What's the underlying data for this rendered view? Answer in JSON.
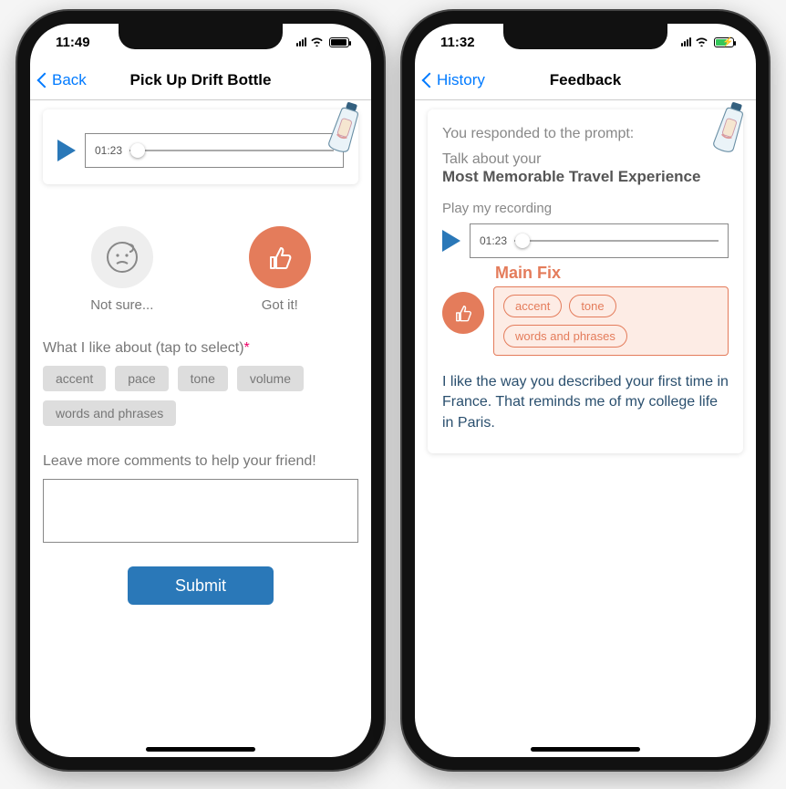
{
  "left": {
    "status_time": "11:49",
    "back_label": "Back",
    "title": "Pick Up Drift Bottle",
    "time_code": "01:23",
    "not_sure_label": "Not sure...",
    "got_it_label": "Got it!",
    "like_label_prefix": "What I like about (tap to select)",
    "chips": [
      "accent",
      "pace",
      "tone",
      "volume",
      "words and phrases"
    ],
    "comment_label": "Leave more comments to help your friend!",
    "submit_label": "Submit"
  },
  "right": {
    "status_time": "11:32",
    "back_label": "History",
    "title": "Feedback",
    "intro": "You responded to the prompt:",
    "topic_prefix": "Talk about your",
    "topic": "Most Memorable Travel Experience",
    "play_label": "Play my recording",
    "time_code": "01:23",
    "mainfix_label": "Main Fix",
    "fix_chips": [
      "accent",
      "tone",
      "words and phrases"
    ],
    "feedback_text": "I like the way you described your first time in France. That reminds me of my college life in Paris."
  },
  "colors": {
    "accent_orange": "#e47c5b",
    "accent_blue": "#2a78b8",
    "ios_blue": "#007aff"
  }
}
